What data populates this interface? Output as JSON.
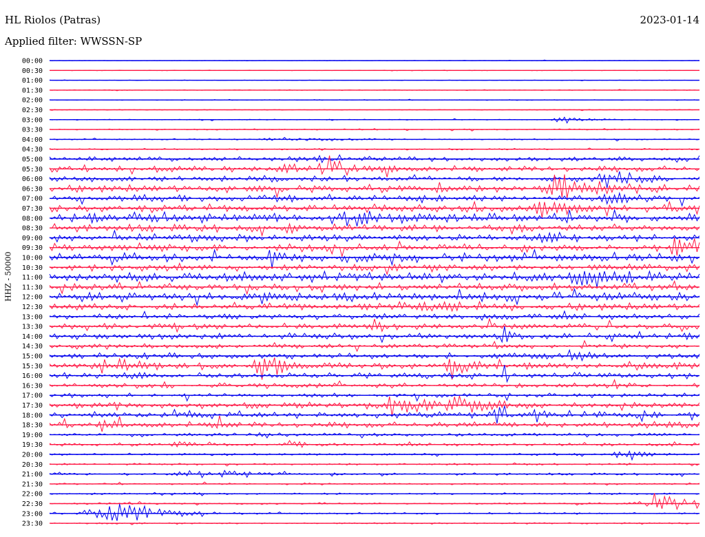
{
  "header": {
    "station": "HL Riolos (Patras)",
    "date": "2023-01-14",
    "filter": "Applied filter: WWSSN-SP"
  },
  "chart_data": {
    "type": "line",
    "ylabel": "HHZ - 50000",
    "colors": {
      "a": "#0000ee",
      "b": "#ff1744"
    },
    "rows": [
      {
        "t": "00:00",
        "c": "a",
        "lvl": 0.3,
        "events": []
      },
      {
        "t": "00:30",
        "c": "b",
        "lvl": 0.4,
        "events": []
      },
      {
        "t": "01:00",
        "c": "a",
        "lvl": 0.3,
        "events": []
      },
      {
        "t": "01:30",
        "c": "b",
        "lvl": 0.5,
        "events": []
      },
      {
        "t": "02:00",
        "c": "a",
        "lvl": 0.5,
        "events": []
      },
      {
        "t": "02:30",
        "c": "b",
        "lvl": 0.5,
        "events": []
      },
      {
        "t": "03:00",
        "c": "a",
        "lvl": 0.6,
        "events": [
          [
            0.79,
            6,
            0.03
          ]
        ]
      },
      {
        "t": "03:30",
        "c": "b",
        "lvl": 0.8,
        "events": []
      },
      {
        "t": "04:00",
        "c": "a",
        "lvl": 0.9,
        "events": [
          [
            0.35,
            3,
            0.06
          ]
        ]
      },
      {
        "t": "04:30",
        "c": "b",
        "lvl": 1.0,
        "events": []
      },
      {
        "t": "05:00",
        "c": "a",
        "lvl": 3.0,
        "events": [
          [
            0.43,
            10,
            0.03
          ]
        ]
      },
      {
        "t": "05:30",
        "c": "b",
        "lvl": 4.0,
        "events": [
          [
            0.43,
            18,
            0.03
          ],
          [
            0.37,
            6,
            0.03
          ]
        ]
      },
      {
        "t": "06:00",
        "c": "a",
        "lvl": 4.0,
        "events": [
          [
            0.86,
            14,
            0.03
          ]
        ]
      },
      {
        "t": "06:30",
        "c": "b",
        "lvl": 5.0,
        "events": [
          [
            0.78,
            22,
            0.05
          ],
          [
            0.28,
            7,
            0.02
          ]
        ]
      },
      {
        "t": "07:00",
        "c": "a",
        "lvl": 5.0,
        "events": [
          [
            0.86,
            8,
            0.02
          ]
        ]
      },
      {
        "t": "07:30",
        "c": "b",
        "lvl": 5.0,
        "events": [
          [
            0.76,
            10,
            0.04
          ]
        ]
      },
      {
        "t": "08:00",
        "c": "a",
        "lvl": 6.0,
        "events": [
          [
            0.47,
            8,
            0.05
          ]
        ]
      },
      {
        "t": "08:30",
        "c": "b",
        "lvl": 5.0,
        "events": [
          [
            0.37,
            8,
            0.02
          ]
        ]
      },
      {
        "t": "09:00",
        "c": "a",
        "lvl": 5.0,
        "events": [
          [
            0.76,
            6,
            0.03
          ]
        ]
      },
      {
        "t": "09:30",
        "c": "b",
        "lvl": 5.0,
        "events": [
          [
            0.97,
            18,
            0.03
          ]
        ]
      },
      {
        "t": "10:00",
        "c": "a",
        "lvl": 6.0,
        "events": [
          [
            0.34,
            10,
            0.02
          ]
        ]
      },
      {
        "t": "10:30",
        "c": "b",
        "lvl": 5.0,
        "events": []
      },
      {
        "t": "11:00",
        "c": "a",
        "lvl": 6.0,
        "events": [
          [
            0.83,
            10,
            0.06
          ]
        ]
      },
      {
        "t": "11:30",
        "c": "b",
        "lvl": 5.0,
        "events": [
          [
            0.13,
            10,
            0.02
          ]
        ]
      },
      {
        "t": "12:00",
        "c": "a",
        "lvl": 6.0,
        "events": []
      },
      {
        "t": "12:30",
        "c": "b",
        "lvl": 5.0,
        "events": [
          [
            0.53,
            6,
            0.05
          ]
        ]
      },
      {
        "t": "13:00",
        "c": "a",
        "lvl": 4.0,
        "events": [
          [
            0.7,
            20,
            0.005
          ]
        ]
      },
      {
        "t": "13:30",
        "c": "b",
        "lvl": 4.0,
        "events": [
          [
            0.5,
            8,
            0.02
          ]
        ]
      },
      {
        "t": "14:00",
        "c": "a",
        "lvl": 4.0,
        "events": [
          [
            0.7,
            14,
            0.01
          ]
        ]
      },
      {
        "t": "14:30",
        "c": "b",
        "lvl": 3.0,
        "events": []
      },
      {
        "t": "15:00",
        "c": "a",
        "lvl": 4.0,
        "events": [
          [
            0.8,
            10,
            0.03
          ]
        ]
      },
      {
        "t": "15:30",
        "c": "b",
        "lvl": 5.0,
        "events": [
          [
            0.33,
            18,
            0.03
          ],
          [
            0.62,
            16,
            0.02
          ],
          [
            0.09,
            10,
            0.03
          ]
        ]
      },
      {
        "t": "16:00",
        "c": "a",
        "lvl": 4.0,
        "events": [
          [
            0.7,
            16,
            0.005
          ]
        ]
      },
      {
        "t": "16:30",
        "c": "b",
        "lvl": 3.0,
        "events": [
          [
            0.87,
            8,
            0.01
          ]
        ]
      },
      {
        "t": "17:00",
        "c": "a",
        "lvl": 3.0,
        "events": [
          [
            0.7,
            12,
            0.005
          ]
        ]
      },
      {
        "t": "17:30",
        "c": "b",
        "lvl": 4.0,
        "events": [
          [
            0.53,
            14,
            0.05
          ],
          [
            0.63,
            12,
            0.04
          ]
        ]
      },
      {
        "t": "18:00",
        "c": "a",
        "lvl": 4.0,
        "events": [
          [
            0.69,
            12,
            0.01
          ],
          [
            0.75,
            12,
            0.01
          ],
          [
            0.83,
            12,
            0.01
          ],
          [
            0.91,
            12,
            0.01
          ],
          [
            0.22,
            12,
            0.01
          ]
        ]
      },
      {
        "t": "18:30",
        "c": "b",
        "lvl": 4.0,
        "events": [
          [
            0.08,
            12,
            0.01
          ],
          [
            0.26,
            20,
            0.005
          ],
          [
            0.95,
            14,
            0.01
          ]
        ]
      },
      {
        "t": "19:00",
        "c": "a",
        "lvl": 2.0,
        "events": [
          [
            0.33,
            4,
            0.02
          ]
        ]
      },
      {
        "t": "19:30",
        "c": "b",
        "lvl": 2.0,
        "events": [
          [
            0.37,
            6,
            0.02
          ],
          [
            0.2,
            4,
            0.02
          ]
        ]
      },
      {
        "t": "20:00",
        "c": "a",
        "lvl": 1.5,
        "events": [
          [
            0.88,
            14,
            0.02
          ]
        ]
      },
      {
        "t": "20:30",
        "c": "b",
        "lvl": 1.2,
        "events": []
      },
      {
        "t": "21:00",
        "c": "a",
        "lvl": 1.5,
        "events": [
          [
            0.22,
            6,
            0.04
          ],
          [
            0.28,
            5,
            0.03
          ],
          [
            0.43,
            4,
            0.01
          ]
        ]
      },
      {
        "t": "21:30",
        "c": "b",
        "lvl": 1.2,
        "events": []
      },
      {
        "t": "22:00",
        "c": "a",
        "lvl": 1.2,
        "events": [
          [
            0.17,
            4,
            0.02
          ]
        ]
      },
      {
        "t": "22:30",
        "c": "b",
        "lvl": 1.2,
        "events": [
          [
            0.94,
            18,
            0.05
          ]
        ]
      },
      {
        "t": "23:00",
        "c": "a",
        "lvl": 1.2,
        "events": [
          [
            0.09,
            22,
            0.06
          ]
        ]
      },
      {
        "t": "23:30",
        "c": "b",
        "lvl": 1.0,
        "events": []
      }
    ]
  }
}
